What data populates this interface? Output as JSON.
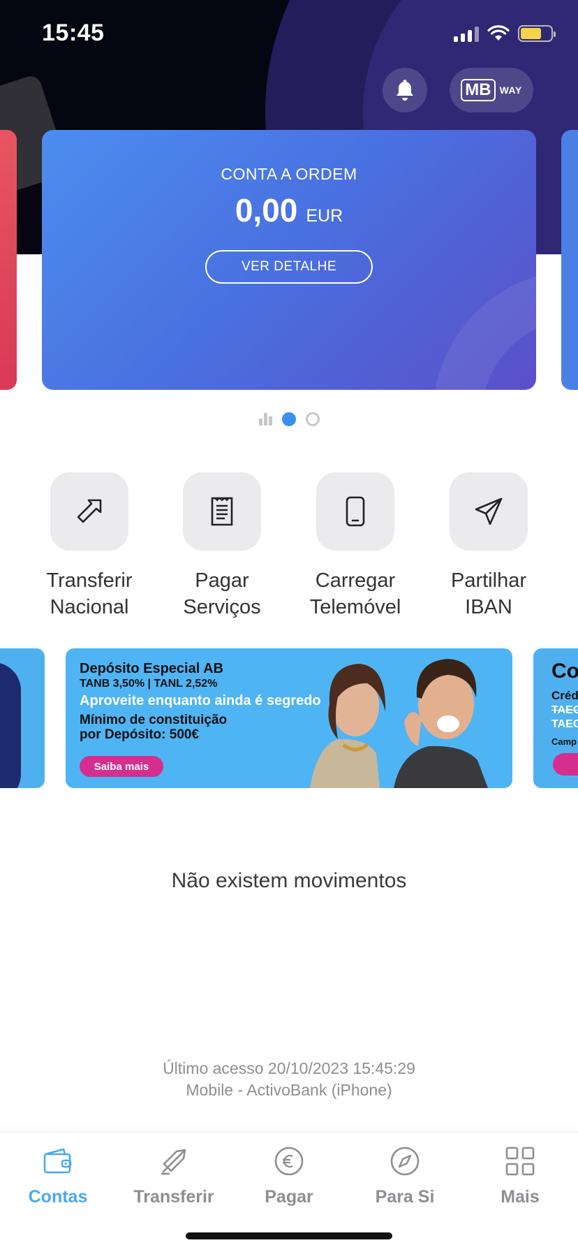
{
  "status_bar": {
    "time": "15:45"
  },
  "header": {
    "mbway_logo": "MB",
    "mbway_suffix": "WAY"
  },
  "account_card": {
    "type": "CONTA A ORDEM",
    "balance": "0,00",
    "currency": "EUR",
    "detail_button": "VER DETALHE"
  },
  "pager": {
    "active_index": 1,
    "pages": 3
  },
  "quick_actions": [
    {
      "line1": "Transferir",
      "line2": "Nacional",
      "icon": "arrow-up-right-icon"
    },
    {
      "line1": "Pagar",
      "line2": "Serviços",
      "icon": "receipt-icon"
    },
    {
      "line1": "Carregar",
      "line2": "Telemóvel",
      "icon": "phone-icon"
    },
    {
      "line1": "Partilhar",
      "line2": "IBAN",
      "icon": "send-icon"
    }
  ],
  "promo": {
    "title": "Depósito Especial AB",
    "rates": "TANB 3,50% | TANL 2,52%",
    "tagline": "Aproveite enquanto ainda é segredo",
    "min_line1": "Mínimo de constituição",
    "min_line2": "por Depósito: 500€",
    "cta": "Saiba mais"
  },
  "promo_right": {
    "title": "Co",
    "line1": "Créd",
    "line2": "TAEG",
    "line3": "TAEG",
    "line4": "Camp"
  },
  "movements": {
    "empty_message": "Não existem movimentos"
  },
  "last_access": {
    "line1": "Último acesso 20/10/2023 15:45:29",
    "line2": "Mobile - ActivoBank (iPhone)"
  },
  "tabs": [
    {
      "label": "Contas",
      "icon": "wallet-icon",
      "active": true
    },
    {
      "label": "Transferir",
      "icon": "transfer-icon",
      "active": false
    },
    {
      "label": "Pagar",
      "icon": "euro-icon",
      "active": false
    },
    {
      "label": "Para Si",
      "icon": "compass-icon",
      "active": false
    },
    {
      "label": "Mais",
      "icon": "grid-icon",
      "active": false
    }
  ],
  "colors": {
    "accent": "#4aa8f0",
    "card_gradient_start": "#4c8ef0",
    "card_gradient_end": "#5b4fc8",
    "promo_bg": "#4fb4f4",
    "promo_cta": "#d52e8f"
  }
}
